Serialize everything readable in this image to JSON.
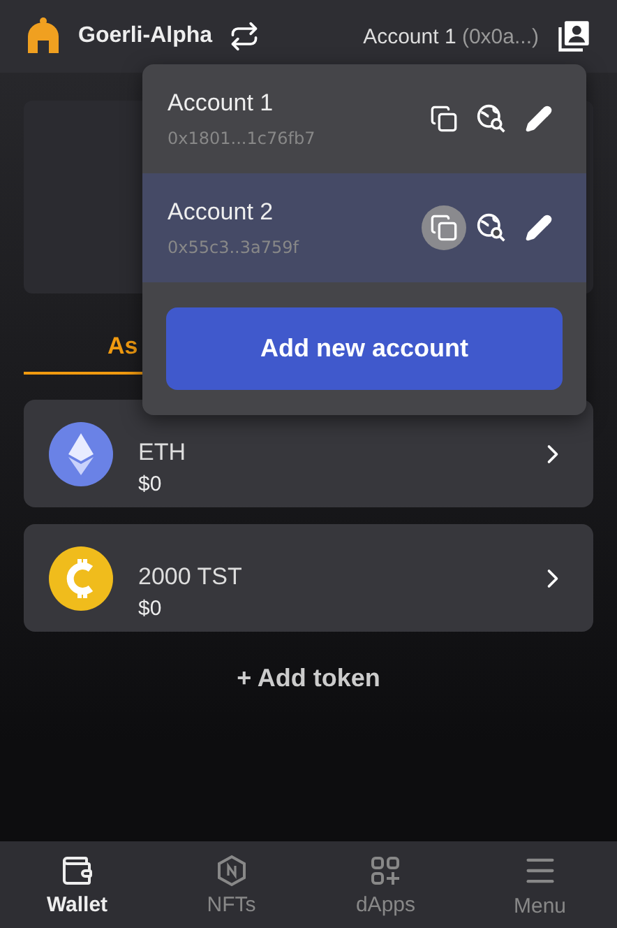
{
  "header": {
    "network": "Goerli-Alpha",
    "account_name": "Account 1",
    "account_address": "(0x0a...)"
  },
  "tabs": [
    {
      "label": "As",
      "selected": true
    }
  ],
  "tokens": [
    {
      "kind": "eth",
      "name": "ETH",
      "value": "$0"
    },
    {
      "kind": "coin",
      "name": "2000 TST",
      "value": "$0"
    }
  ],
  "add_token": "+ Add token",
  "account_menu": {
    "accounts": [
      {
        "name": "Account 1",
        "address": "0x1801...1c76fb7",
        "selected": false,
        "copy_hovered": false
      },
      {
        "name": "Account 2",
        "address": "0x55c3..3a759f",
        "selected": true,
        "copy_hovered": true
      }
    ],
    "add_button": "Add new account"
  },
  "nav": [
    {
      "kind": "wallet",
      "label": "Wallet",
      "selected": true
    },
    {
      "kind": "nfts",
      "label": "NFTs",
      "selected": false
    },
    {
      "kind": "dapps",
      "label": "dApps",
      "selected": false
    },
    {
      "kind": "menu",
      "label": "Menu",
      "selected": false
    }
  ]
}
